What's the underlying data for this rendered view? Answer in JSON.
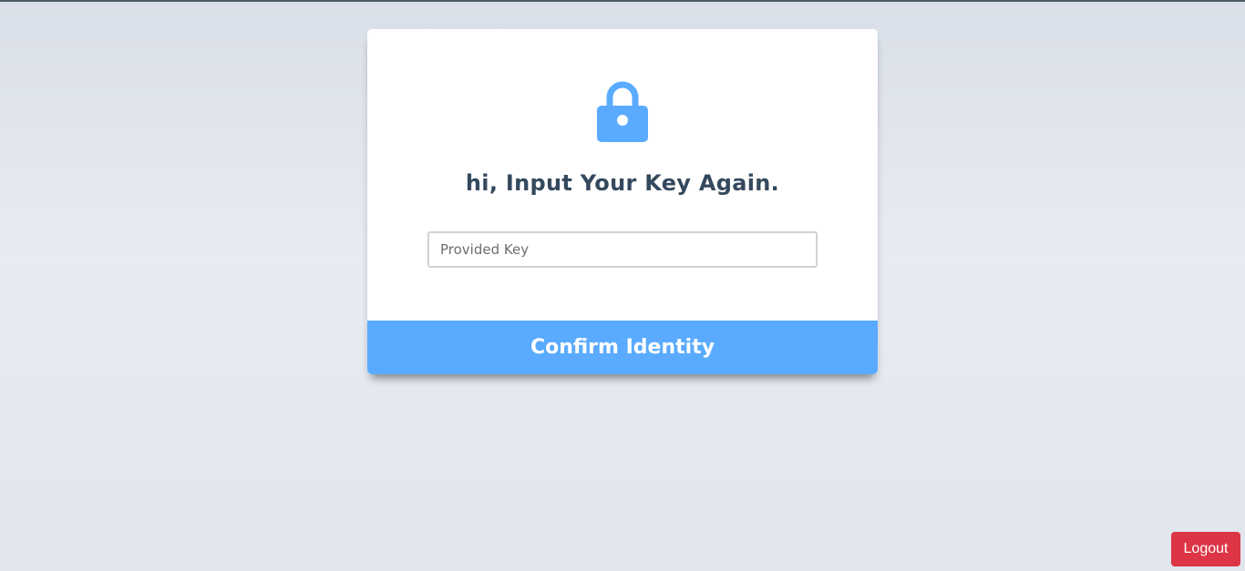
{
  "auth_card": {
    "lock_icon": "lock-icon",
    "heading": "hi, Input Your Key Again.",
    "key_input": {
      "value": "",
      "placeholder": "Provided Key"
    },
    "confirm_label": "Confirm Identity"
  },
  "logout_label": "Logout",
  "colors": {
    "accent": "#5aabff",
    "heading": "#34495e",
    "danger": "#dc3545",
    "card": "#ffffff"
  }
}
